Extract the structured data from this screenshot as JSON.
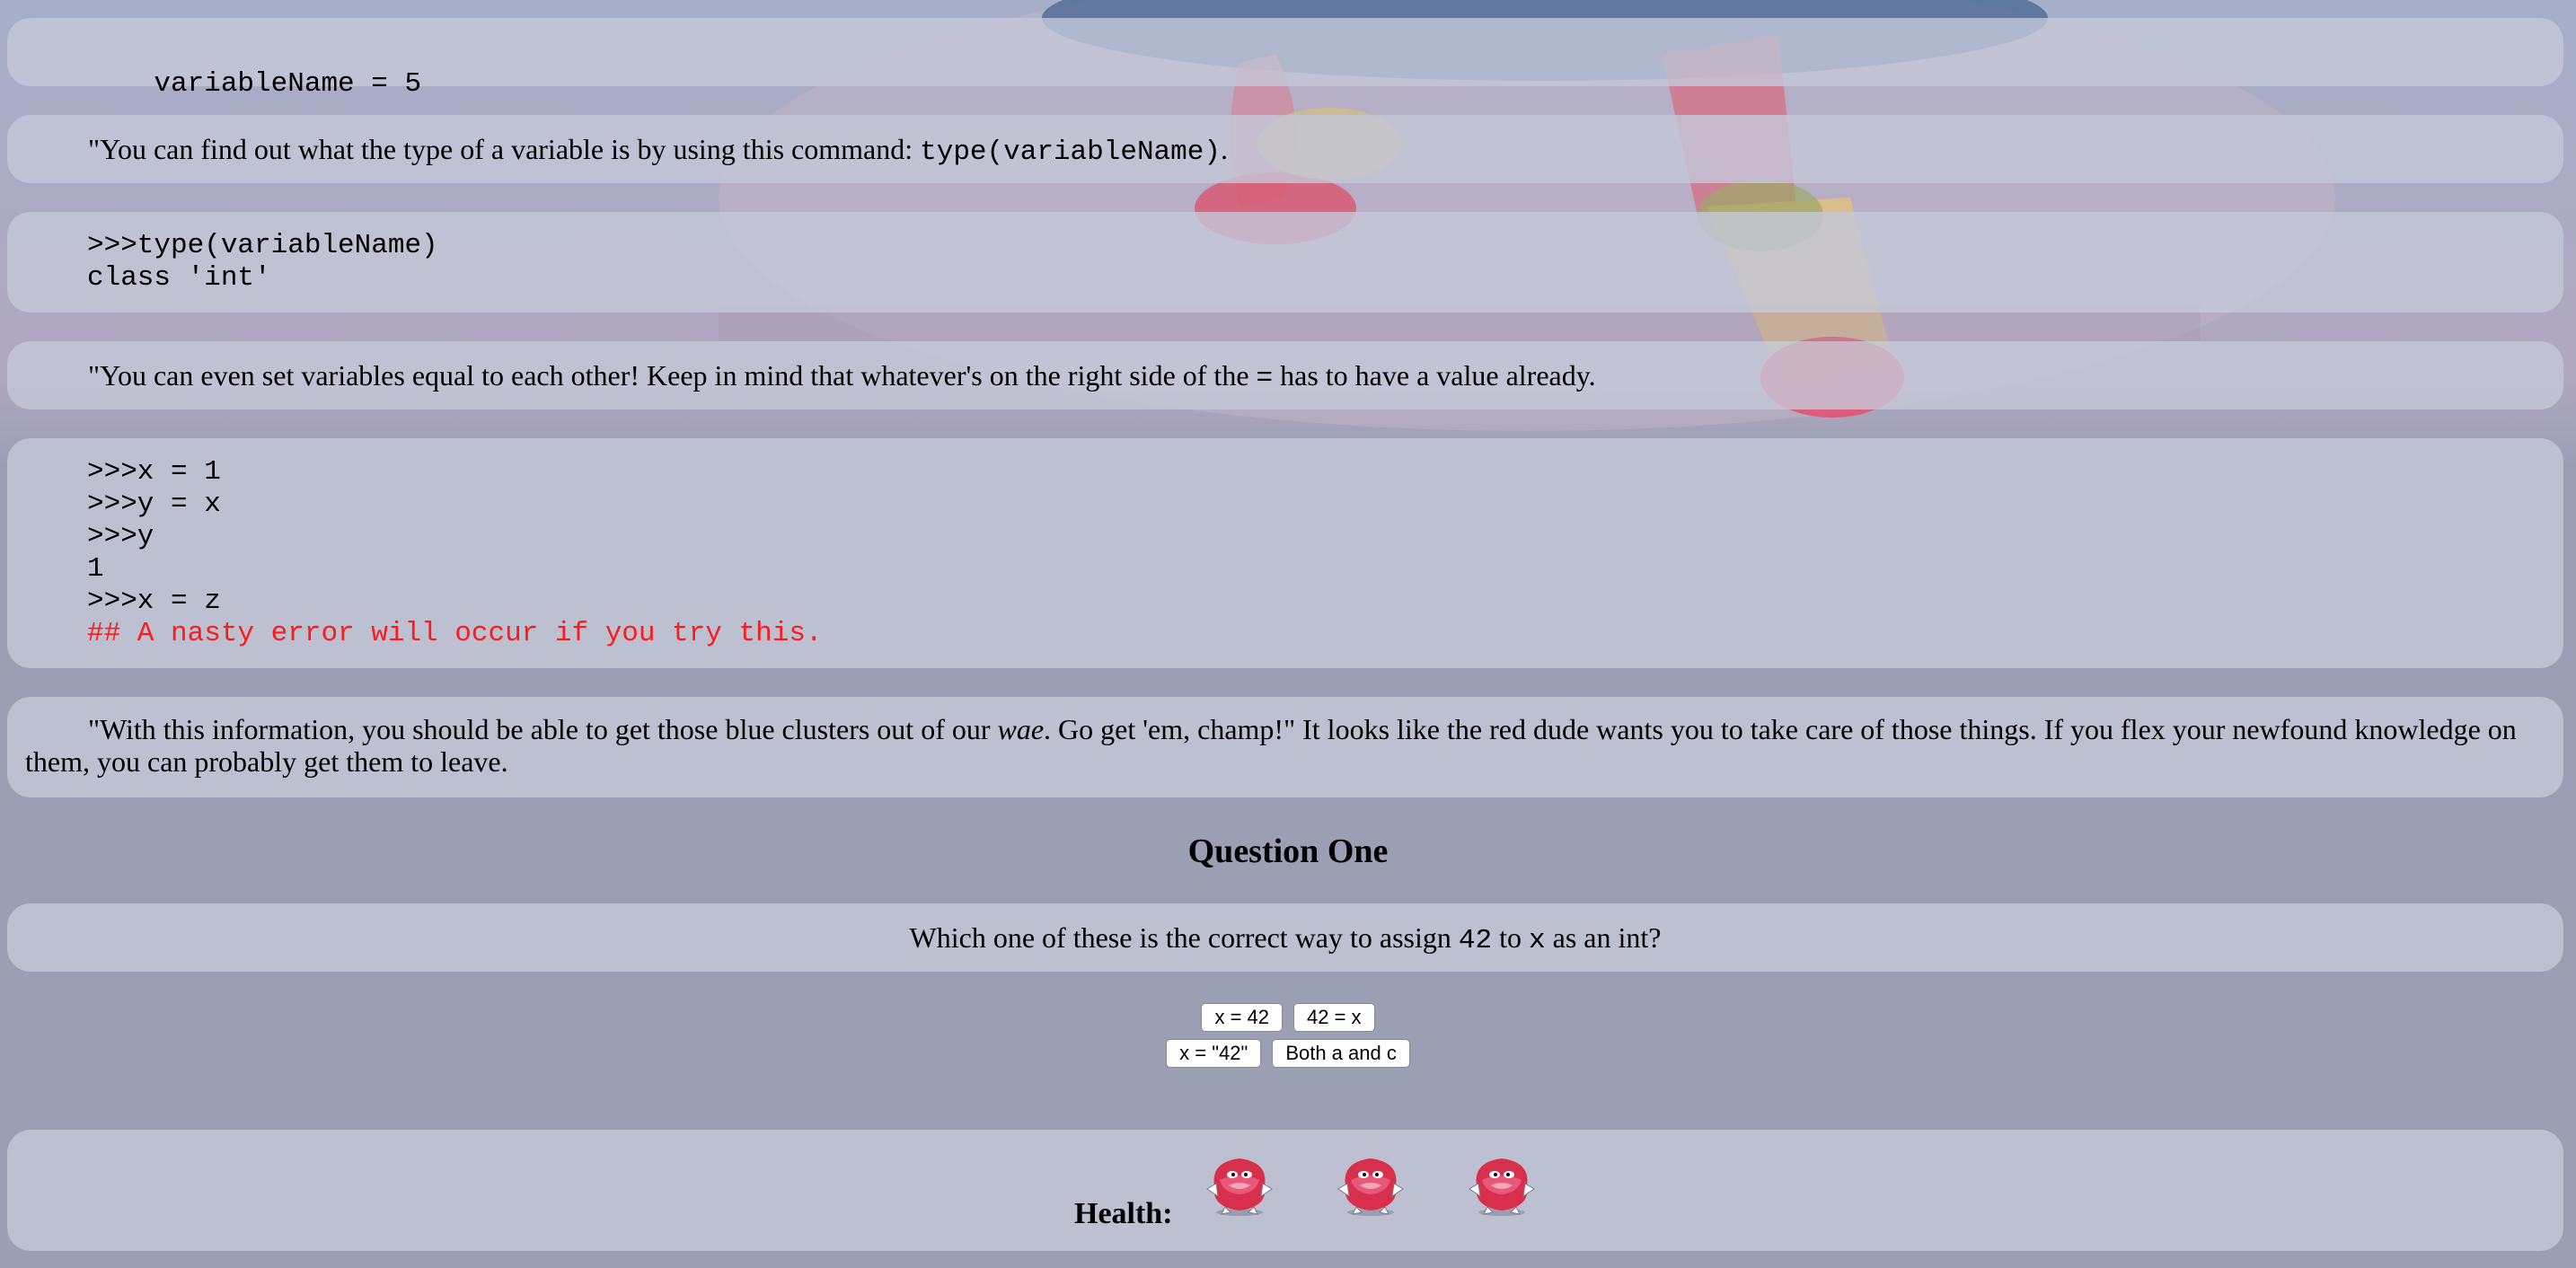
{
  "blocks": {
    "code1": "variableName = 5",
    "text1_before": "\"You can find out what the type of a variable is by using this command: ",
    "text1_code": "type(variableName)",
    "text1_after": ".",
    "code2_lines": [
      ">>>type(variableName)",
      "class 'int'"
    ],
    "text2_before": "\"You can even set variables equal to each other! Keep in mind that whatever's on the right side of the ",
    "text2_code": "=",
    "text2_after": " has to have a value already.",
    "code3_lines": [
      ">>>x = 1",
      ">>>y = x",
      ">>>y",
      "1",
      ">>>x = z"
    ],
    "code3_error": "## A nasty error will occur if you try this.",
    "text3_before": "\"With this information, you should be able to get those blue clusters out of our ",
    "text3_em": "wae",
    "text3_after": ". Go get 'em, champ!\" It looks like the red dude wants you to take care of those things. If you flex your newfound knowledge on them, you can probably get them to leave."
  },
  "question": {
    "title": "Question One",
    "prompt_before": "Which one of these is the correct way to assign ",
    "prompt_code1": "42",
    "prompt_middle": " to ",
    "prompt_code2": "x",
    "prompt_after": " as an int?",
    "answers": [
      "x = 42",
      "42 = x",
      "x = \"42\"",
      "Both a and c"
    ]
  },
  "health": {
    "label": "Health:",
    "lives": 3,
    "life_icon": "red-knuckles-sprite-icon"
  },
  "colors": {
    "panel": "#c4c8d8",
    "background": "#9a9fb4",
    "error_text": "#ff1a1a"
  }
}
